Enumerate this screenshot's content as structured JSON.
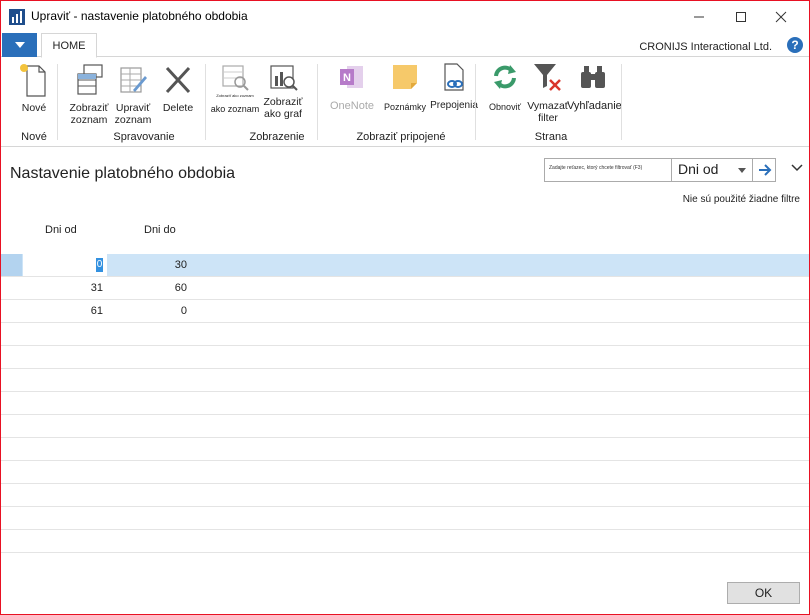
{
  "window": {
    "title": "Upraviť - nastavenie platobného obdobia",
    "controls": {
      "minimize_icon": "minimize-icon",
      "maximize_icon": "maximize-icon",
      "close_icon": "close-icon"
    }
  },
  "ribbon_tabs": {
    "file_menu_icon": "caret-down-icon",
    "home_label": "HOME",
    "company": "CRONIJS Interactional Ltd.",
    "help_glyph": "?"
  },
  "ribbon": {
    "groups": {
      "nove": "Nové",
      "spravovanie": "Spravovanie",
      "zobrazenie": "Zobrazenie",
      "zobrazit_pripojene": "Zobraziť pripojené",
      "strana": "Strana"
    },
    "buttons": {
      "new": "Nové",
      "show_list_1": "Zobraziť",
      "show_list_2": "zoznam",
      "edit_list_1": "Upraviť",
      "edit_list_2": "zoznam",
      "delete": "Delete",
      "as_list_tiny": "Zobraziť ako zoznam",
      "as_list": "ako zoznam",
      "as_chart_1": "Zobraziť",
      "as_chart_2": "ako graf",
      "onenote": "OneNote",
      "notes": "Poznámky",
      "links": "Prepojenia",
      "refresh": "Obnoviť",
      "clear_filter_1": "Vymazať",
      "clear_filter_2": "filter",
      "find": "Vyhľadanie"
    }
  },
  "page": {
    "title": "Nastavenie platobného obdobia",
    "filter": {
      "hint": "Zadajte reťazec, ktorý chcete filtrovať (F3)",
      "field": "Dni od"
    },
    "no_filters": "Nie sú použité žiadne filtre"
  },
  "table": {
    "columns": [
      "Dni od",
      "Dni do"
    ],
    "rows": [
      {
        "dni_od": "0",
        "dni_do": "30"
      },
      {
        "dni_od": "31",
        "dni_do": "60"
      },
      {
        "dni_od": "61",
        "dni_do": "0"
      }
    ],
    "selected_row": 0
  },
  "footer": {
    "ok_label": "OK"
  },
  "colors": {
    "accent": "#2a6fba",
    "selection": "#cde4f7",
    "window_border": "#e81123",
    "refresh_green": "#3a9a6a",
    "clear_red": "#d9342b",
    "onenote_purple": "#b67bc9",
    "notes_yellow": "#f6c96a"
  }
}
